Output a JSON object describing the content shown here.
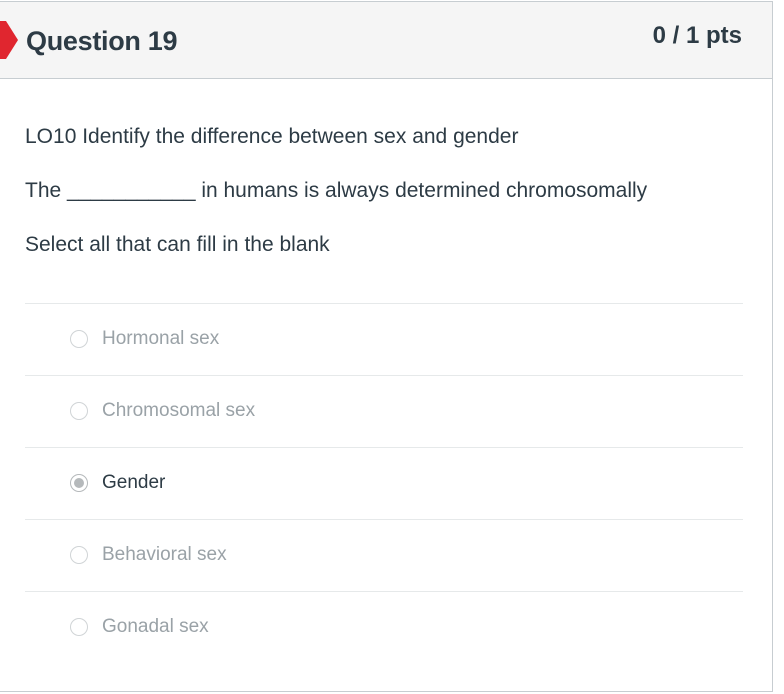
{
  "question": {
    "title": "Question 19",
    "points": "0 / 1 pts",
    "flag_color": "#e0262f",
    "lines": [
      "LO10 Identify the difference between sex and gender",
      "The ___________ in humans is always determined chromosomally",
      "Select all that can fill in the blank"
    ]
  },
  "answers": [
    {
      "label": "Hormonal sex",
      "selected": false
    },
    {
      "label": "Chromosomal sex",
      "selected": false
    },
    {
      "label": "Gender",
      "selected": true
    },
    {
      "label": "Behavioral sex",
      "selected": false
    },
    {
      "label": "Gonadal sex",
      "selected": false
    }
  ]
}
